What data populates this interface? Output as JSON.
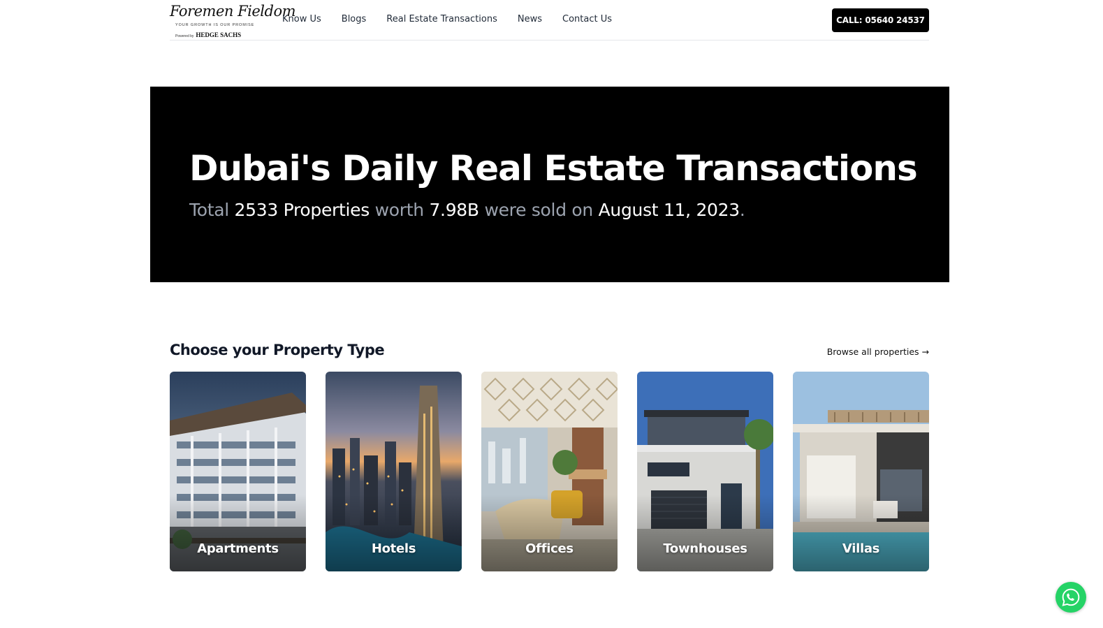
{
  "brand": {
    "logo_script": "Foremen Fieldom",
    "logo_tagline": "YOUR GROWTH IS OUR PROMISE",
    "powered_by": "Powered by",
    "partner": "HEDGE SACHS"
  },
  "nav": {
    "items": [
      {
        "label": "Know Us"
      },
      {
        "label": "Blogs"
      },
      {
        "label": "Real Estate Transactions"
      },
      {
        "label": "News"
      },
      {
        "label": "Contact Us"
      }
    ],
    "call_label": "CALL: 05640 24537"
  },
  "hero": {
    "title": "Dubai's Daily Real Estate Transactions",
    "sub_total": "Total",
    "sub_count": "2533 Properties",
    "sub_worth": "worth",
    "sub_amount": "7.98B",
    "sub_sold": "were sold on",
    "sub_date": "August 11, 2023",
    "sub_period": "."
  },
  "property_types": {
    "title": "Choose your Property Type",
    "browse_label": "Browse all properties →",
    "cards": [
      {
        "label": "Apartments"
      },
      {
        "label": "Hotels"
      },
      {
        "label": "Offices"
      },
      {
        "label": "Townhouses"
      },
      {
        "label": "Villas"
      }
    ]
  },
  "colors": {
    "hero_bg": "#000000",
    "hero_muted_text": "#9ca3af",
    "whatsapp": "#25d366"
  },
  "icons": {
    "chat": "whatsapp-icon"
  }
}
